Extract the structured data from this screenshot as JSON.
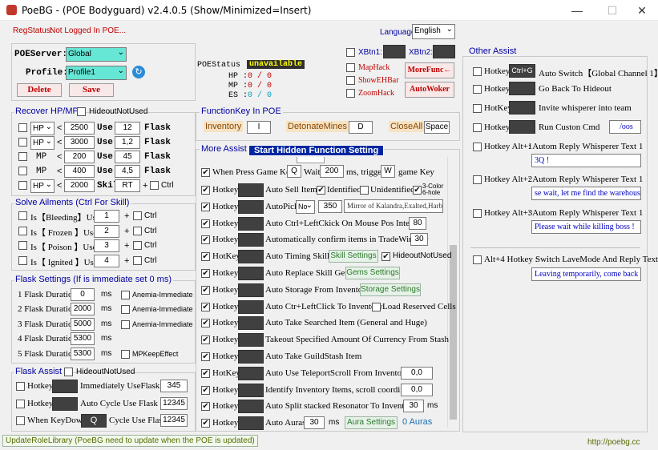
{
  "window": {
    "title": "PoeBG - (POE Bodyguard) v2.4.0.5  (Show/Minimized=Insert)",
    "minimize": "—",
    "maximize": "☐",
    "close": "✕"
  },
  "reg": {
    "label": "RegStatus:",
    "value": "Not Logged In POE..."
  },
  "language": {
    "label": "Language:",
    "value": "English"
  },
  "server": {
    "label": "POEServer:",
    "value": "Global"
  },
  "profile": {
    "label": "Profile:",
    "value": "Profile1"
  },
  "buttons": {
    "delete": "Delete",
    "save": "Save",
    "more_func": "MoreFunc←",
    "auto_woker": "AutoWoker"
  },
  "status": {
    "label": "POEStatus :",
    "value": "unavailable",
    "hp_label": "HP :",
    "hp": "0 / 0",
    "mp_label": "MP :",
    "mp": "0 / 0",
    "es_label": "ES :",
    "es": "0 / 0"
  },
  "xbtn": {
    "x1": "XBtn1:",
    "x2": "XBtn2:"
  },
  "toggles": {
    "maphack": "MapHack",
    "showehbar": "ShowEHBar",
    "zoomhack": "ZoomHack"
  },
  "recover": {
    "title": "Recover HP/MP",
    "hideout": "HideoutNotUsed",
    "rows": [
      {
        "type": "HP",
        "op": "<",
        "val": "2500",
        "use": "Use",
        "flask": "12",
        "tail": "Flask"
      },
      {
        "type": "HP",
        "op": "<",
        "val": "3000",
        "use": "Use",
        "flask": "1,2",
        "tail": "Flask"
      },
      {
        "type": "MP",
        "op": "<",
        "val": "200",
        "use": "Use",
        "flask": "45",
        "tail": "Flask"
      },
      {
        "type": "MP",
        "op": "<",
        "val": "400",
        "use": "Use",
        "flask": "4,5",
        "tail": "Flask"
      },
      {
        "type": "HP",
        "op": "<",
        "val": "2000",
        "use": "Skill",
        "flask": "RT",
        "tail": "Ctrl"
      }
    ]
  },
  "ailments": {
    "title": "Solve Ailments (Ctrl For Skill)",
    "rows": [
      {
        "label": "Is【Bleeding】Use",
        "val": "1",
        "ctrl": "Ctrl"
      },
      {
        "label": "Is【 Frozen 】Use",
        "val": "2",
        "ctrl": "Ctrl"
      },
      {
        "label": "Is【 Poison 】Use",
        "val": "3",
        "ctrl": "Ctrl"
      },
      {
        "label": "Is【 Ignited 】Use",
        "val": "4",
        "ctrl": "Ctrl"
      }
    ]
  },
  "flask_settings": {
    "title": "Flask Settings (If is immediate set 0 ms)",
    "rows": [
      {
        "label": "1 Flask Duration",
        "val": "0",
        "unit": "ms",
        "extra": "Anemia-Immediate"
      },
      {
        "label": "2 Flask Duration",
        "val": "2000",
        "unit": "ms",
        "extra": "Anemia-Immediate"
      },
      {
        "label": "3 Flask Duration",
        "val": "5000",
        "unit": "ms",
        "extra": "Anemia-Immediate"
      },
      {
        "label": "4 Flask Duration",
        "val": "5300",
        "unit": "ms",
        "extra": ""
      },
      {
        "label": "5 Flask Duration",
        "val": "5300",
        "unit": "ms",
        "extra": "MPKeepEffect"
      }
    ]
  },
  "flask_assist": {
    "title": "Flask Assist",
    "hideout": "HideoutNotUsed",
    "rows": [
      {
        "label": "Hotkey",
        "text": "Immediately UseFlask",
        "val": "345"
      },
      {
        "label": "Hotkey",
        "text": "Auto Cycle Use Flask",
        "val": "12345"
      },
      {
        "label": "When KeyDown",
        "key": "Q",
        "text": "Cycle Use Flask",
        "val": "12345"
      }
    ]
  },
  "function_key": {
    "title": "FunctionKey In POE",
    "inventory": "Inventory",
    "inventory_key": "I",
    "detonate": "DetonateMines",
    "detonate_key": "D",
    "closeall": "CloseAll",
    "closeall_key": "Space"
  },
  "more_assist": {
    "title": "More Assist",
    "start_btn": "Start Hidden Function Setting",
    "game_key": {
      "label": "When Press Game Key",
      "key": "Q",
      "wait": "Wait",
      "wait_val": "200",
      "unit": "ms, trigger",
      "trigger": "W",
      "tail": "game Key"
    },
    "rows": [
      {
        "hk": "Hotkey",
        "text": "Auto Sell Items"
      },
      {
        "hk": "Hotkey",
        "text": "AutoPick"
      },
      {
        "hk": "Hotkey",
        "text": "Auto Ctrl+LeftCkick On Mouse Pos Interval"
      },
      {
        "hk": "Hotkey",
        "text": "Automatically confirm items in TradeWindow"
      },
      {
        "hk": "HotKey",
        "text": "Auto Timing Skills"
      },
      {
        "hk": "Hotkey",
        "text": "Auto Replace Skill Gems"
      },
      {
        "hk": "Hotkey",
        "text": "Auto Storage From Inventory"
      },
      {
        "hk": "Hotkey",
        "text": "Auto Ctr+LeftClick To Inventory"
      },
      {
        "hk": "Hotkey",
        "text": "Auto Take Searched Item (General and Huge)"
      },
      {
        "hk": "Hotkey",
        "text": "Takeout Specified Amount Of Currency From Stash"
      },
      {
        "hk": "Hotkey",
        "text": "Auto Take GuildStash Item"
      },
      {
        "hk": "HotKey",
        "text": "Auto Use TeleportScroll From Inventory"
      },
      {
        "hk": "Hotkey",
        "text": "Identify Inventory Items, scroll coordinates"
      },
      {
        "hk": "Hotkey",
        "text": "Auto Split stacked Resonator To Inventory"
      },
      {
        "hk": "Hotkey",
        "text": "Auto Auras"
      }
    ],
    "sell": {
      "identified": "Identified",
      "unidentified": "Unidentified",
      "color": "3-Color",
      "hole": "6-hole"
    },
    "pick": {
      "mode": "No",
      "val": "350",
      "filter": "Mirror of Kalandra,Exalted,Harb"
    },
    "interval": "80",
    "trade": "30",
    "timing": {
      "btn": "Skill Settings",
      "hideout": "HideoutNotUsed"
    },
    "gems_btn": "Gems Settings",
    "storage_btn": "Storage Settings",
    "reserved": "Load Reserved Cells",
    "teleport": "0,0",
    "identify": "0,0",
    "split": "30",
    "split_unit": "ms",
    "auras": {
      "val": "30",
      "unit": "ms",
      "btn": "Aura Settings",
      "count": "0 Auras"
    }
  },
  "other": {
    "title": "Other Assist",
    "rows": [
      {
        "hk": "Hotkey",
        "key": "Ctrl+G",
        "text": "Auto Switch【Global Channel 1】"
      },
      {
        "hk": "Hotkey",
        "key": "",
        "text": "Go Back To Hideout"
      },
      {
        "hk": "HotKey",
        "key": "",
        "text": "Invite whisperer into team"
      },
      {
        "hk": "Hotkey",
        "key": "",
        "text": "Run Custon Cmd",
        "cmd": "/oos"
      }
    ],
    "replies": [
      {
        "hk": "Hotkey Alt+1",
        "text": ": Autom Reply Whisperer Text 1",
        "val": "3Q !"
      },
      {
        "hk": "Hotkey Alt+2",
        "text": ": Autom Reply Whisperer Text 1",
        "val": "se wait, let me find the warehouse !"
      },
      {
        "hk": "Hotkey Alt+3",
        "text": ": Autom Reply Whisperer Text 1",
        "val": "Please wait while killing boss !"
      }
    ],
    "leave": {
      "hk": "Alt+4 Hotkey :",
      "text": "Switch LaveMode And Reply Text",
      "val": "Leaving temporarily, come back qu"
    }
  },
  "footer": {
    "update": "UpdateRoleLibrary (PoeBG need to update when the POE is updated)",
    "url": "http://poebg.cc"
  },
  "colors": {
    "accent_green": "#66e6d5",
    "title_blue": "#0000a0",
    "red": "#c00000",
    "unavailable_bg": "#303030",
    "unavailable_fg": "#ffff00"
  }
}
